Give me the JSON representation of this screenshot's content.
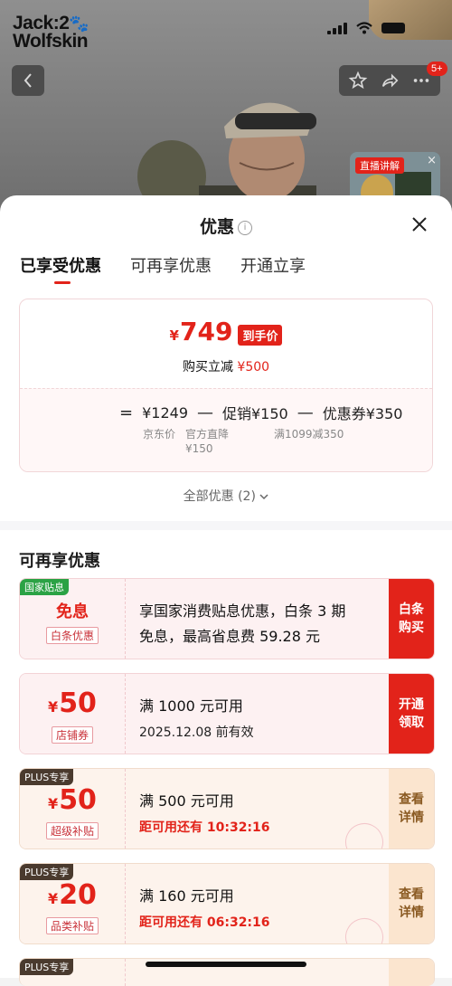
{
  "brand": {
    "line1": "Jack",
    "line2": "Wolfskin",
    "mark": "🐾"
  },
  "top": {
    "badge": "5+"
  },
  "live": {
    "label": "直播讲解"
  },
  "sheet": {
    "title": "优惠",
    "tabs": [
      {
        "label": "已享受优惠"
      },
      {
        "label": "可再享优惠"
      },
      {
        "label": "开通立享"
      }
    ],
    "price": {
      "currency": "¥",
      "final": "749",
      "final_tag": "到手价",
      "save_prefix": "购买立减",
      "save_amount": "¥500",
      "formula": {
        "eq": "=",
        "jd_price": "¥1249",
        "minus": "—",
        "promo": "促销¥150",
        "coupon": "优惠券¥350",
        "jd_label": "京东价",
        "promo_label_1": "官方直降",
        "promo_label_2": "¥150",
        "coupon_label": "满1099减350"
      }
    },
    "all_offers": "全部优惠 (2)",
    "section_title": "可再享优惠",
    "coupons": [
      {
        "tag": "国家贴息",
        "word": "免息",
        "sub": "白条优惠",
        "main": "享国家消费贴息优惠，白条 3 期",
        "main2": "免息，最高省息费 59.28 元",
        "action1": "白条",
        "action2": "购买"
      },
      {
        "currency": "¥",
        "amount": "50",
        "sub": "店铺券",
        "main": "满 1000 元可用",
        "detail": "2025.12.08 前有效",
        "action1": "开通",
        "action2": "领取"
      },
      {
        "tag": "PLUS专享",
        "currency": "¥",
        "amount": "50",
        "sub": "超级补贴",
        "main": "满 500 元可用",
        "detail": "距可用还有 10:32:16",
        "action1": "查看",
        "action2": "详情"
      },
      {
        "tag": "PLUS专享",
        "currency": "¥",
        "amount": "20",
        "sub": "品类补贴",
        "main": "满 160 元可用",
        "detail": "距可用还有 06:32:16",
        "action1": "查看",
        "action2": "详情"
      },
      {
        "tag": "PLUS专享"
      }
    ]
  },
  "colors": {
    "accent": "#e2231a",
    "plus_gold": "#8a5a22"
  }
}
